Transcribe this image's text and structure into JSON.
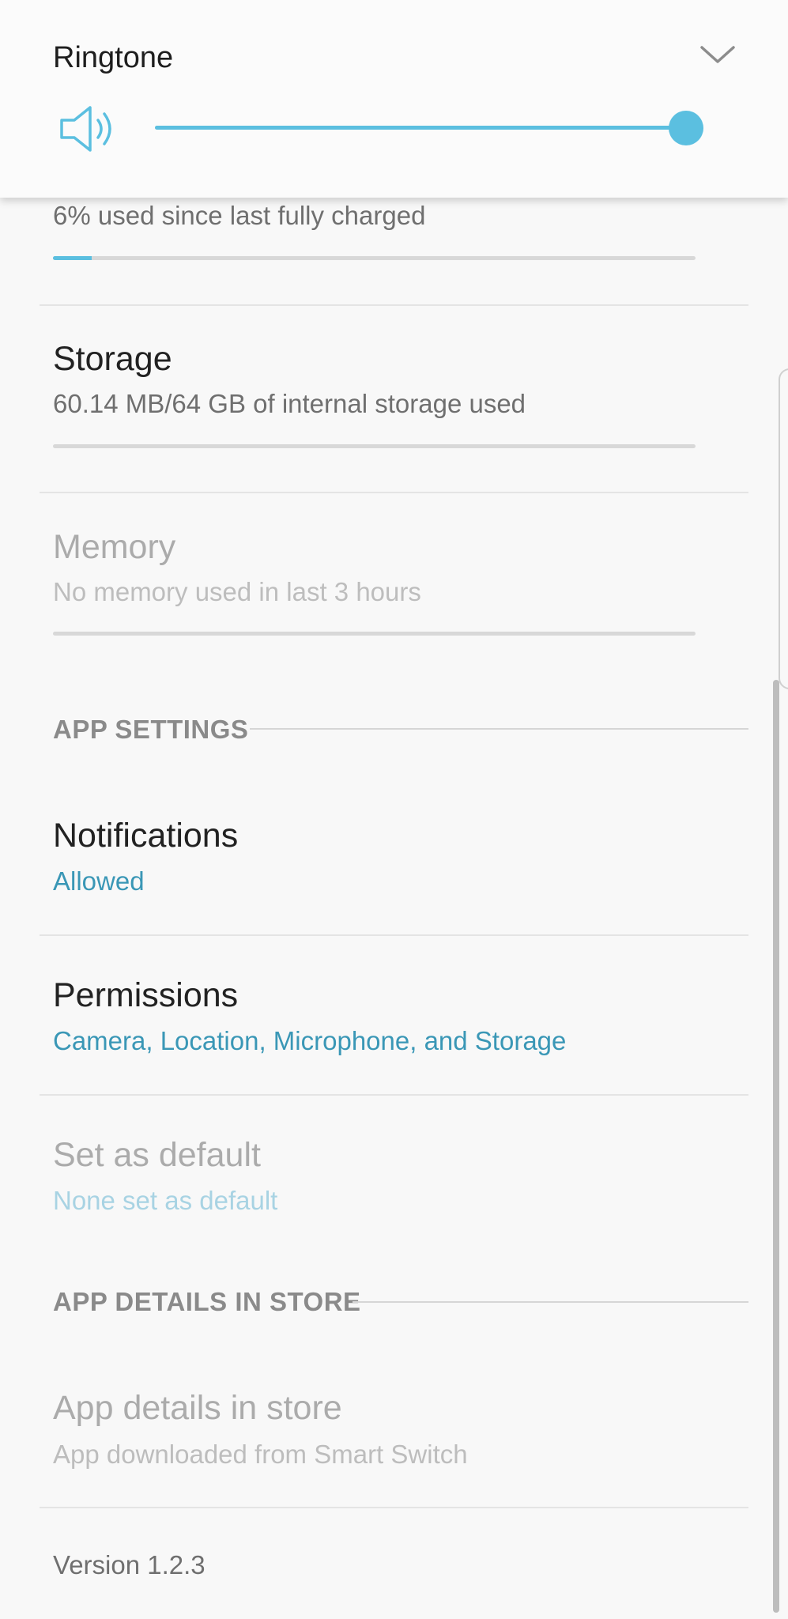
{
  "volume_panel": {
    "title": "Ringtone",
    "speaker_icon": "speaker-volume-icon",
    "expand_icon": "chevron-down-icon",
    "volume_level": 1.0,
    "accent_color": "#5bbfe0"
  },
  "battery": {
    "subtitle": "6% used since last fully charged",
    "usage_fraction": 0.06
  },
  "storage": {
    "title": "Storage",
    "subtitle": "60.14 MB/64 GB of internal storage used",
    "usage_fraction": 0.0
  },
  "memory": {
    "title": "Memory",
    "subtitle": "No memory used in last 3 hours",
    "usage_fraction": 0.0
  },
  "app_settings": {
    "header": "APP SETTINGS",
    "notifications": {
      "title": "Notifications",
      "subtitle": "Allowed"
    },
    "permissions": {
      "title": "Permissions",
      "subtitle": "Camera, Location, Microphone, and Storage"
    },
    "set_as_default": {
      "title": "Set as default",
      "subtitle": "None set as default"
    }
  },
  "app_details": {
    "header": "APP DETAILS IN STORE",
    "item": {
      "title": "App details in store",
      "subtitle": "App downloaded from Smart Switch"
    }
  },
  "version": "Version 1.2.3",
  "colors": {
    "link_blue": "#3a97b6",
    "link_blue_disabled": "#a8d3e3",
    "background": "#f8f8f8"
  }
}
